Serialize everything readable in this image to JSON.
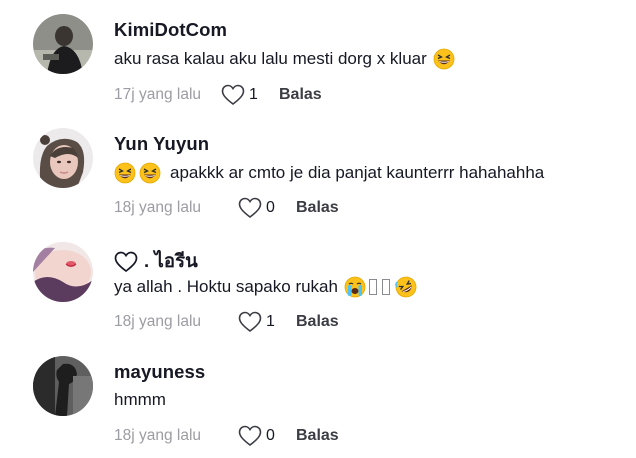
{
  "comments": [
    {
      "username": "KimiDotCom",
      "text": "aku rasa kalau aku lalu mesti dorg x kluar",
      "emojis_after": [
        "grinning-squint-face"
      ],
      "time": "17j yang lalu",
      "likes": "1",
      "reply_label": "Balas"
    },
    {
      "username": "Yun Yuyun",
      "emojis_before": [
        "grinning-squint-face",
        "grinning-squint-face"
      ],
      "text": "apakkk ar cmto je dia panjat kaunterrr hahahahha",
      "time": "18j yang lalu",
      "likes": "0",
      "reply_label": "Balas"
    },
    {
      "username_icon": "heart-outline-icon",
      "username": ". ไอรีน",
      "text": "ya allah . Hoktu sapako rukah",
      "emojis_after": [
        "loudly-crying-face",
        "missing-glyph",
        "missing-glyph",
        "rolling-on-floor-laughing-face"
      ],
      "time": "18j yang lalu",
      "likes": "1",
      "reply_label": "Balas"
    },
    {
      "username": "mayuness",
      "text": "hmmm",
      "time": "18j yang lalu",
      "likes": "0",
      "reply_label": "Balas"
    }
  ],
  "colors": {
    "username": "#161823",
    "text": "#161823",
    "time": "#9c9ca3",
    "reply": "#3c3d44",
    "emoji_face": "#fcc21b"
  }
}
